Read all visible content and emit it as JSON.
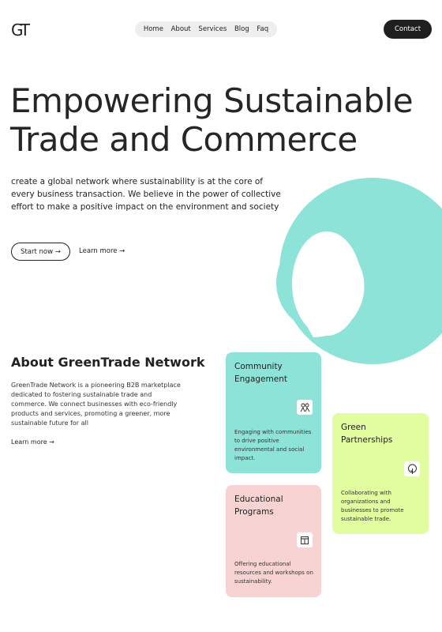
{
  "brand": {
    "logo_text": "GT"
  },
  "nav": {
    "items": [
      "Home",
      "About",
      "Services",
      "Blog",
      "Faq"
    ]
  },
  "header": {
    "contact_label": "Contact"
  },
  "hero": {
    "title_line1": "Empowering Sustainable",
    "title_line2": "Trade and Commerce",
    "description": "create a global network where sustainability is at the core of every business transaction. We believe in the power of collective effort to make a positive impact on the environment and society",
    "start_label": "Start now →",
    "learn_label": "Learn more →"
  },
  "about": {
    "title": "About GreenTrade Network",
    "description": "GreenTrade Network is a pioneering B2B marketplace dedicated to fostering sustainable trade and commerce. We connect businesses with eco-friendly products and services, promoting a greener, more sustainable future for all",
    "learn_label": "Learn more →"
  },
  "cards": [
    {
      "title": "Community Engagement",
      "text": "Engaging with communities to drive positive environmental and social impact.",
      "icon": "people-icon",
      "color": "#8ee3d8"
    },
    {
      "title": "Green Partnerships",
      "text": "Collaborating with organizations and businesses to promote sustainable trade.",
      "icon": "tree-icon",
      "color": "#e2fd9f"
    },
    {
      "title": "Educational Programs",
      "text": "Offering educational resources and workshops on sustainability.",
      "icon": "book-icon",
      "color": "#f8d3d3"
    }
  ],
  "colors": {
    "accent_teal": "#8ee3d8",
    "dark": "#1f1f1f"
  }
}
